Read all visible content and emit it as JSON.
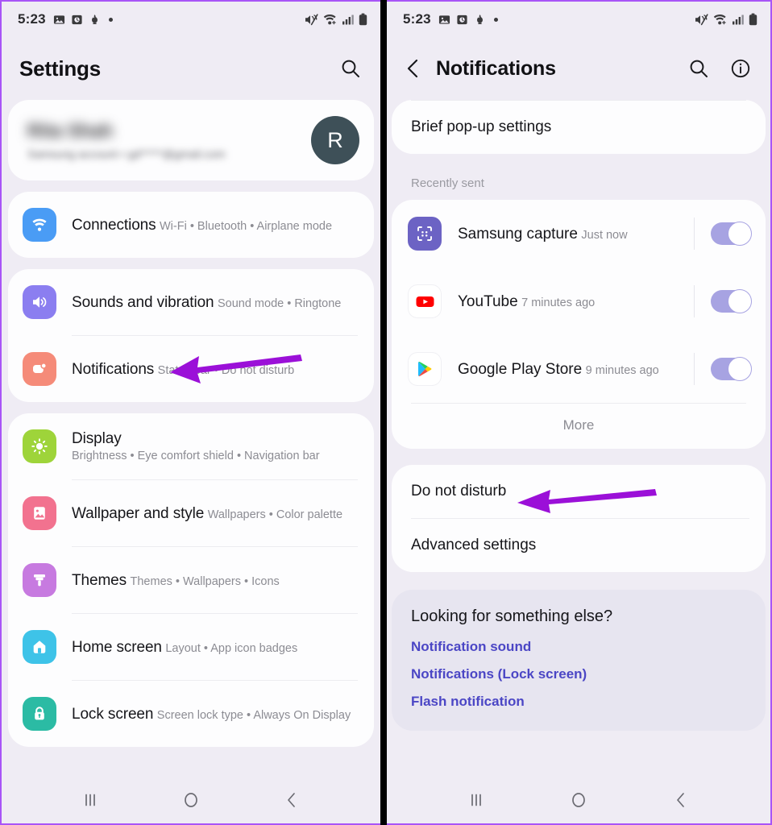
{
  "accent": {
    "arrow": "#9b10d8",
    "link": "#4b46c5",
    "toggle_on": "#a7a3e2",
    "frame": "#a855f7"
  },
  "status_bar": {
    "time": "5:23",
    "left_icons": [
      "image-icon",
      "clock-icon",
      "app-icon",
      "dot-icon"
    ],
    "right_icons": [
      "mute-icon",
      "wifi-icon",
      "signal-icon",
      "battery-icon"
    ]
  },
  "left_screen": {
    "appbar": {
      "title": "Settings",
      "search_icon": "search-icon"
    },
    "profile": {
      "name": "Rita Shah",
      "subtitle": "Samsung account  •  gd*****@gmail.com",
      "avatar_initial": "R"
    },
    "groups": [
      {
        "items": [
          {
            "icon": "wifi-icon",
            "color": "#4a9cf5",
            "title": "Connections",
            "subtitle": "Wi-Fi  •  Bluetooth  •  Airplane mode"
          }
        ]
      },
      {
        "items": [
          {
            "icon": "volume-icon",
            "color": "#8b7ef0",
            "title": "Sounds and vibration",
            "subtitle": "Sound mode  •  Ringtone"
          },
          {
            "icon": "notification-bubble-icon",
            "color": "#f58b79",
            "title": "Notifications",
            "subtitle": "Status bar  •  Do not disturb",
            "highlighted": true
          }
        ]
      },
      {
        "items": [
          {
            "icon": "brightness-icon",
            "color": "#9ed43a",
            "title": "Display",
            "subtitle": "Brightness  •  Eye comfort shield  •  Navigation bar"
          },
          {
            "icon": "wallpaper-icon",
            "color": "#f2728f",
            "title": "Wallpaper and style",
            "subtitle": "Wallpapers  •  Color palette"
          },
          {
            "icon": "paintbrush-icon",
            "color": "#c77ae0",
            "title": "Themes",
            "subtitle": "Themes  •  Wallpapers  •  Icons"
          },
          {
            "icon": "home-icon",
            "color": "#3ec3e8",
            "title": "Home screen",
            "subtitle": "Layout  •  App icon badges"
          },
          {
            "icon": "lock-icon",
            "color": "#2bbba4",
            "title": "Lock screen",
            "subtitle": "Screen lock type  •  Always On Display"
          }
        ]
      }
    ]
  },
  "right_screen": {
    "appbar": {
      "title": "Notifications",
      "back_icon": "chevron-left-icon",
      "search_icon": "search-icon",
      "info_icon": "info-icon"
    },
    "brief_popup_row": "Brief pop-up settings",
    "recently_sent_label": "Recently sent",
    "apps": [
      {
        "name": "Samsung capture",
        "time": "Just now",
        "icon": "samsung-capture-icon",
        "enabled": true
      },
      {
        "name": "YouTube",
        "time": "7 minutes ago",
        "icon": "youtube-icon",
        "enabled": true
      },
      {
        "name": "Google Play Store",
        "time": "9 minutes ago",
        "icon": "play-store-icon",
        "enabled": true
      }
    ],
    "more_label": "More",
    "settings_rows": [
      {
        "label": "Do not disturb",
        "highlighted": true
      },
      {
        "label": "Advanced settings",
        "highlighted": false
      }
    ],
    "looking": {
      "heading": "Looking for something else?",
      "links": [
        "Notification sound",
        "Notifications (Lock screen)",
        "Flash notification"
      ]
    }
  },
  "nav_bar": {
    "recents": "recents-icon",
    "home": "home-circle-icon",
    "back": "back-chevron-icon"
  }
}
